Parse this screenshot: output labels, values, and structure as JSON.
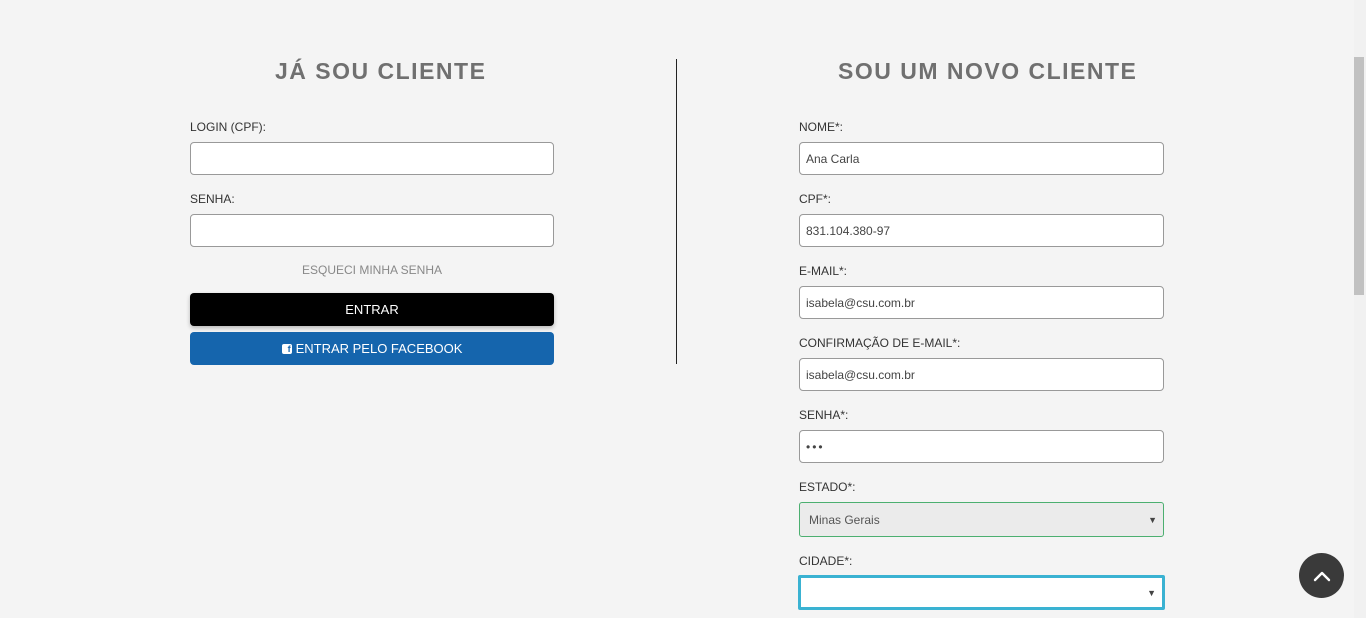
{
  "login": {
    "title": "JÁ SOU CLIENTE",
    "login_label": "LOGIN (CPF):",
    "login_value": "",
    "password_label": "SENHA:",
    "password_value": "",
    "forgot_link": "ESQUECI MINHA SENHA",
    "enter_button": "ENTRAR",
    "facebook_button": "ENTRAR PELO FACEBOOK",
    "facebook_icon": "facebook-icon",
    "facebook_color": "#1565ad"
  },
  "register": {
    "title": "SOU UM NOVO CLIENTE",
    "name_label": "NOME*:",
    "name_value": "Ana Carla",
    "cpf_label": "CPF*:",
    "cpf_value": "831.104.380-97",
    "email_label": "E-MAIL*:",
    "email_value": "isabela@csu.com.br",
    "email_confirm_label": "CONFIRMAÇÃO DE E-MAIL*:",
    "email_confirm_value": "isabela@csu.com.br",
    "password_label": "SENHA*:",
    "password_value": "•••",
    "state_label": "ESTADO*:",
    "state_value": "Minas Gerais",
    "city_label": "CIDADE*:",
    "city_value": ""
  },
  "icons": {
    "select_arrow": "▼",
    "back_to_top": "chevron-up-icon"
  },
  "colors": {
    "state_valid_border": "#4caf70",
    "city_focus_border": "#3ab2d2"
  }
}
